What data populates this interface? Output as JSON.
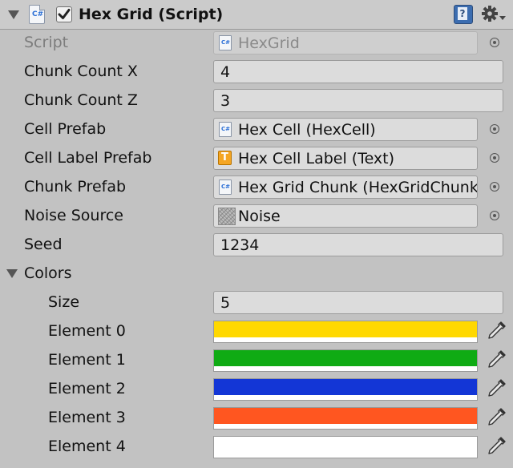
{
  "component": {
    "title": "Hex Grid (Script)",
    "enabled": true,
    "icons": {
      "script": "csharp-script-icon",
      "help": "help-book-icon",
      "settings": "gear-icon"
    }
  },
  "fields": {
    "script": {
      "label": "Script",
      "value": "HexGrid"
    },
    "chunk_count_x": {
      "label": "Chunk Count X",
      "value": "4"
    },
    "chunk_count_z": {
      "label": "Chunk Count Z",
      "value": "3"
    },
    "cell_prefab": {
      "label": "Cell Prefab",
      "value": "Hex Cell (HexCell)"
    },
    "cell_label_prefab": {
      "label": "Cell Label Prefab",
      "value": "Hex Cell Label (Text)"
    },
    "chunk_prefab": {
      "label": "Chunk Prefab",
      "value": "Hex Grid Chunk (HexGridChunk)"
    },
    "noise_source": {
      "label": "Noise Source",
      "value": "Noise"
    },
    "seed": {
      "label": "Seed",
      "value": "1234"
    }
  },
  "colors": {
    "label": "Colors",
    "size_label": "Size",
    "size": "5",
    "elements": [
      {
        "label": "Element 0",
        "color": "#ffd800"
      },
      {
        "label": "Element 1",
        "color": "#0fab14"
      },
      {
        "label": "Element 2",
        "color": "#1336d6"
      },
      {
        "label": "Element 3",
        "color": "#ff5620"
      },
      {
        "label": "Element 4",
        "color": "#ffffff"
      }
    ]
  }
}
